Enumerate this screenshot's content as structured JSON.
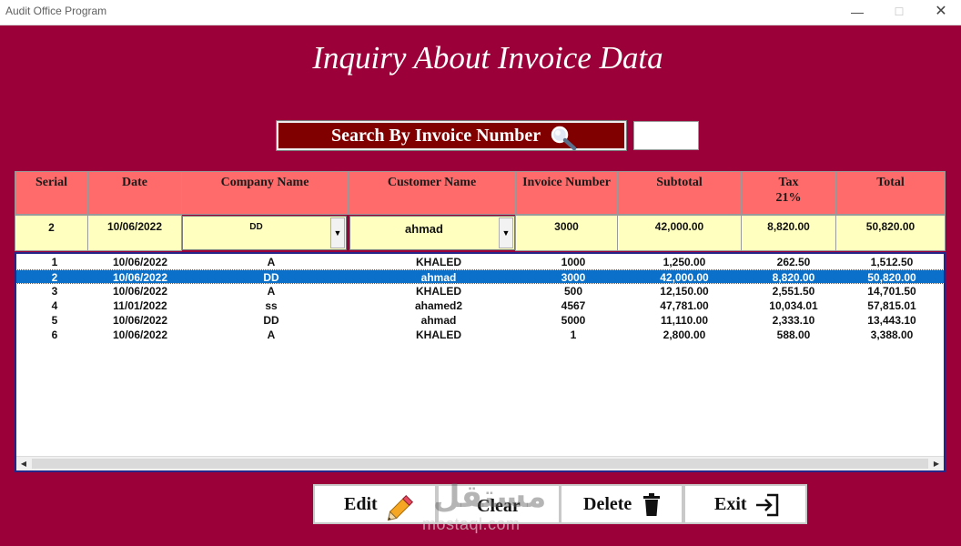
{
  "window": {
    "title": "Audit Office Program",
    "controls": {
      "minimize": "—",
      "maximize": "☐",
      "close": "✕"
    }
  },
  "page": {
    "title": "Inquiry About Invoice Data"
  },
  "search": {
    "button_label": "Search By Invoice Number",
    "icon": "magnifier-icon",
    "input_value": ""
  },
  "columns": [
    {
      "label": "Serial"
    },
    {
      "label": "Date"
    },
    {
      "label": "Company Name"
    },
    {
      "label": "Customer Name"
    },
    {
      "label": "Invoice Number"
    },
    {
      "label": "Subtotal"
    },
    {
      "label": "Tax",
      "sublabel": "21%"
    },
    {
      "label": "Total"
    }
  ],
  "entry": {
    "serial": "2",
    "date": "10/06/2022",
    "company": "DD",
    "customer": "ahmad",
    "invoice": "3000",
    "subtotal": "42,000.00",
    "tax": "8,820.00",
    "total": "50,820.00"
  },
  "rows": [
    {
      "serial": "1",
      "date": "10/06/2022",
      "company": "A",
      "customer": "KHALED",
      "invoice": "1000",
      "subtotal": "1,250.00",
      "tax": "262.50",
      "total": "1,512.50",
      "selected": false
    },
    {
      "serial": "2",
      "date": "10/06/2022",
      "company": "DD",
      "customer": "ahmad",
      "invoice": "3000",
      "subtotal": "42,000.00",
      "tax": "8,820.00",
      "total": "50,820.00",
      "selected": true
    },
    {
      "serial": "3",
      "date": "10/06/2022",
      "company": "A",
      "customer": "KHALED",
      "invoice": "500",
      "subtotal": "12,150.00",
      "tax": "2,551.50",
      "total": "14,701.50",
      "selected": false
    },
    {
      "serial": "4",
      "date": "11/01/2022",
      "company": "ss",
      "customer": "ahamed2",
      "invoice": "4567",
      "subtotal": "47,781.00",
      "tax": "10,034.01",
      "total": "57,815.01",
      "selected": false
    },
    {
      "serial": "5",
      "date": "10/06/2022",
      "company": "DD",
      "customer": "ahmad",
      "invoice": "5000",
      "subtotal": "11,110.00",
      "tax": "2,333.10",
      "total": "13,443.10",
      "selected": false
    },
    {
      "serial": "6",
      "date": "10/06/2022",
      "company": "A",
      "customer": "KHALED",
      "invoice": "1",
      "subtotal": "2,800.00",
      "tax": "588.00",
      "total": "3,388.00",
      "selected": false
    }
  ],
  "actions": {
    "edit": "Edit",
    "clear": "Clear",
    "delete": "Delete",
    "exit": "Exit"
  },
  "watermark": {
    "main": "مستقل",
    "sub": "mostaql.com"
  },
  "colors": {
    "background": "#9b0038",
    "header_cell": "#ff6b6b",
    "entry_cell": "#ffffc0",
    "search_button": "#800000",
    "selected_row": "#0a70c9"
  }
}
